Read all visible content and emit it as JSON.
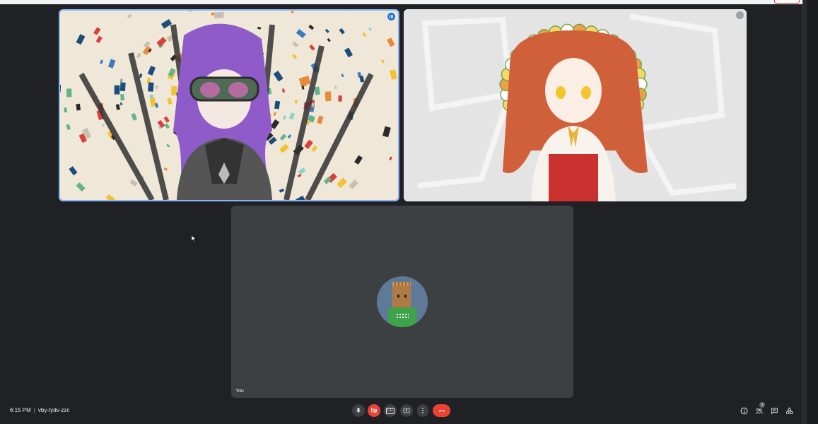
{
  "meeting": {
    "time": "6:15 PM",
    "separator": "|",
    "code": "vby-tydv-zzc"
  },
  "participants": [
    {
      "name": "",
      "speaking": true
    },
    {
      "name": "",
      "muted": true
    },
    {
      "name": "You",
      "avatar": "boxhead-avatar"
    }
  ],
  "controls": {
    "mic": "mic-icon",
    "camera": "camera-off-icon",
    "captions": "CC",
    "present": "present-icon",
    "more": "more-vert-icon",
    "leave": "call-end-icon"
  },
  "right_controls": {
    "info": "info-icon",
    "people": "people-icon",
    "people_count": "3",
    "chat": "chat-icon",
    "activities": "activities-icon"
  },
  "colors": {
    "background": "#202124",
    "tile": "#3c4043",
    "active_border": "#8ab4f8",
    "leave_red": "#ea4335"
  }
}
